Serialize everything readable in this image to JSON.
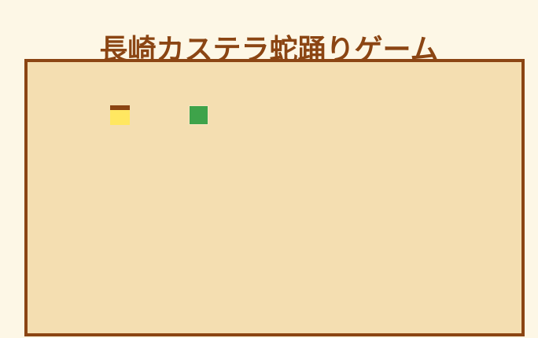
{
  "title": "長崎カステラ蛇踊りゲーム",
  "colors": {
    "page_background": "#fdf7e6",
    "title": "#8b4513",
    "board_background": "#f4deb1",
    "board_border": "#8b4513",
    "castella_sponge": "#ffe761",
    "castella_crust": "#8b4513",
    "snake": "#3ea34a"
  },
  "game": {
    "grid_unit": "cell",
    "castella_cell": {
      "col": 4,
      "row": 2
    },
    "snake_cells": [
      {
        "col": 8,
        "row": 2
      }
    ]
  }
}
